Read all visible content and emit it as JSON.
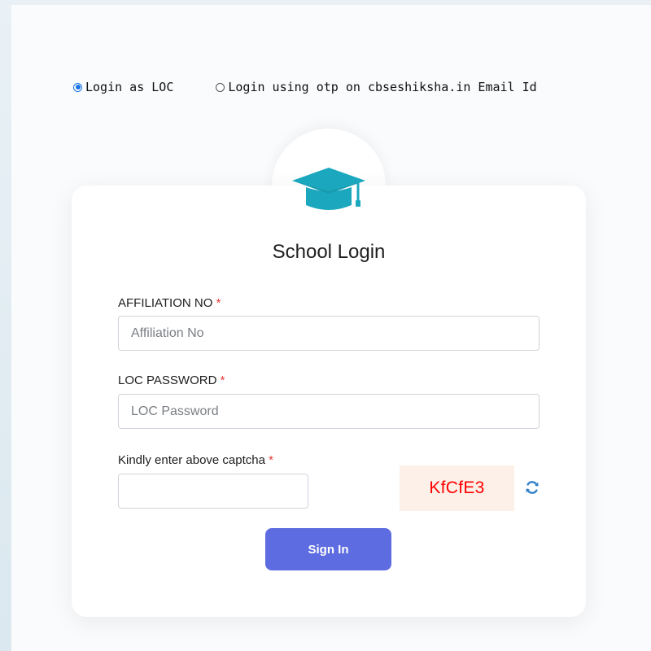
{
  "login_mode": {
    "options": [
      {
        "label": "Login as LOC",
        "selected": true
      },
      {
        "label": "Login using otp on cbseshiksha.in Email Id",
        "selected": false
      }
    ]
  },
  "card": {
    "icon": "graduation-cap-icon",
    "title": "School Login"
  },
  "fields": {
    "affiliation": {
      "label": "AFFILIATION NO",
      "required_mark": "*",
      "placeholder": "Affiliation No",
      "value": ""
    },
    "password": {
      "label": "LOC PASSWORD",
      "required_mark": "*",
      "placeholder": "LOC Password",
      "value": ""
    },
    "captcha": {
      "label": "Kindly enter above captcha",
      "required_mark": "*",
      "value": "",
      "code": "KfCfE3",
      "refresh_icon": "refresh-icon"
    }
  },
  "actions": {
    "signin_label": "Sign In"
  },
  "colors": {
    "accent": "#5d6ce0",
    "icon_teal": "#1ba8bf",
    "required": "#e53935",
    "captcha_text": "#ff0000",
    "captcha_bg": "#fdf0e8",
    "radio_selected": "#1a73e8"
  }
}
